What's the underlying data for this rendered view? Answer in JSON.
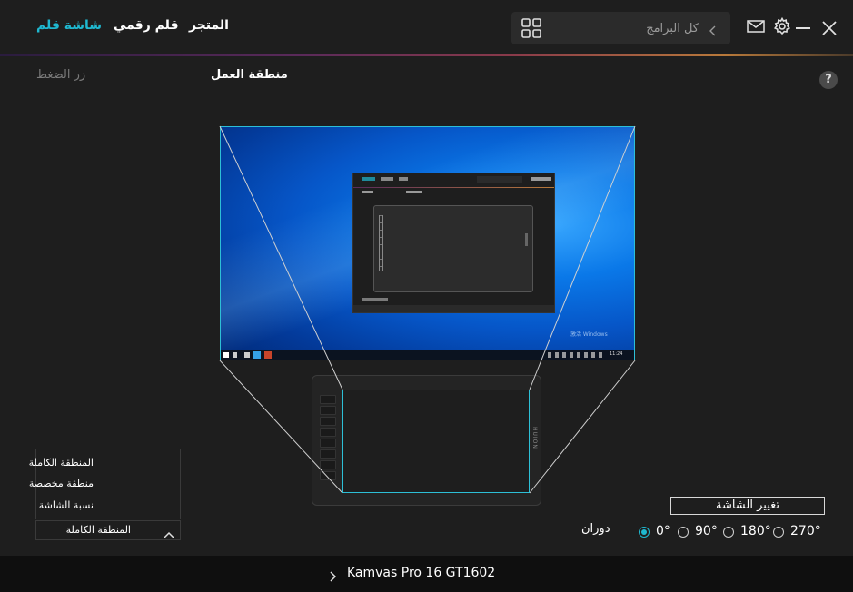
{
  "nav": {
    "tab_pen_display": "شاشة قلم",
    "tab_pen_tablet": "قلم رقمي",
    "tab_store": "المتجر"
  },
  "search": {
    "placeholder": "كل البرامج"
  },
  "workarea": {
    "title": "منطقة العمل",
    "press_key_tab": "زر الضغط"
  },
  "help": {
    "label": "?"
  },
  "mini_screen": {
    "watermark": "激活 Windows",
    "tray_time": "11:24"
  },
  "tablet": {
    "brand": "HUION"
  },
  "mapping": {
    "options": [
      "المنطقة الكاملة",
      "منطقة مخصصة",
      "نسبة الشاشة"
    ],
    "selected": "المنطقة الكاملة"
  },
  "screen_controls": {
    "change_screen_label": "تغيير الشاشة",
    "rotation_label": "دوران",
    "rotation_options": [
      "0°",
      "90°",
      "180°",
      "270°"
    ],
    "rotation_selected": "0°"
  },
  "footer": {
    "device_name": "Kamvas Pro 16 GT1602"
  },
  "colors": {
    "accent": "#1fb8d0",
    "background": "#1e1e1e",
    "footer": "#0f0f0f"
  }
}
